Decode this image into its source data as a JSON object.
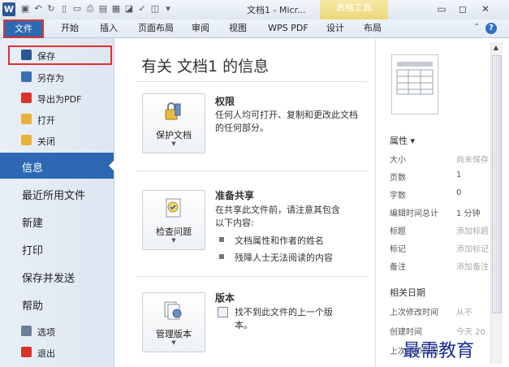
{
  "window": {
    "title": "文档1 - Micr...",
    "context_tab": "表格工具",
    "app_icon_letter": "W",
    "minimize": "▭",
    "maximize": "◻",
    "close": "✕"
  },
  "tabs": {
    "file": "文件",
    "items": [
      "开始",
      "插入",
      "页面布局",
      "审阅",
      "视图",
      "WPS PDF",
      "设计",
      "布局"
    ]
  },
  "backstage": {
    "small_items": [
      {
        "label": "保存",
        "icon": "save-icon",
        "color": "#2b5797"
      },
      {
        "label": "另存为",
        "icon": "save-as-icon",
        "color": "#3b6fb0"
      },
      {
        "label": "导出为PDF",
        "icon": "pdf-icon",
        "color": "#d9342b"
      },
      {
        "label": "打开",
        "icon": "folder-open-icon",
        "color": "#e7b23a"
      },
      {
        "label": "关闭",
        "icon": "close-doc-icon",
        "color": "#e7b23a"
      }
    ],
    "large_items": [
      "信息",
      "最近所用文件",
      "新建",
      "打印",
      "保存并发送",
      "帮助"
    ],
    "bottom_items": [
      {
        "label": "选项",
        "icon": "options-icon",
        "color": "#6a7f99"
      },
      {
        "label": "退出",
        "icon": "exit-icon",
        "color": "#d9342b"
      }
    ]
  },
  "info": {
    "title": "有关 文档1 的信息",
    "sections": [
      {
        "button": "保护文档",
        "icon": "lock-key-icon",
        "heading": "权限",
        "text": "任何人均可打开、复制和更改此文档的任何部分。"
      },
      {
        "button": "检查问题",
        "icon": "inspect-icon",
        "heading": "准备共享",
        "text": "在共享此文件前，请注意其包含以下内容:",
        "bullets": [
          "文档属性和作者的姓名",
          "残障人士无法阅读的内容"
        ]
      },
      {
        "button": "管理版本",
        "icon": "versions-icon",
        "heading": "版本",
        "text": "找不到此文件的上一个版本。"
      }
    ]
  },
  "properties": {
    "header": "属性 ▾",
    "rows": [
      {
        "key": "大小",
        "value": "尚未保存"
      },
      {
        "key": "页数",
        "value": "1"
      },
      {
        "key": "字数",
        "value": "0"
      },
      {
        "key": "编辑时间总计",
        "value": "1 分钟"
      },
      {
        "key": "标题",
        "value": "添加标题"
      },
      {
        "key": "标记",
        "value": "添加标记"
      },
      {
        "key": "备注",
        "value": "添加备注"
      }
    ],
    "dates_header": "相关日期",
    "dates": [
      {
        "key": "上次修改时间",
        "value": "从不"
      },
      {
        "key": "创建时间",
        "value": "今天 20"
      },
      {
        "key": "上次打印时间",
        "value": ""
      }
    ]
  },
  "watermark": "最需教育"
}
